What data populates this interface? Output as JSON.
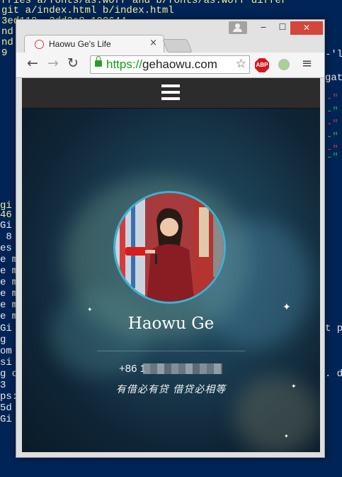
{
  "terminal": {
    "lines": [
      {
        "text": "rries a/fonts/as.woff and b/fonts/as.woff differ",
        "color": "y"
      },
      {
        "text": "git a/index.html b/index.html",
        "color": "y"
      },
      {
        "text": "3ed118..3dd2a8 100644",
        "color": "y"
      },
      {
        "text": "nd",
        "color": "y"
      },
      {
        "text": "nd",
        "color": "y"
      },
      {
        "text": "9",
        "color": "y"
      }
    ],
    "left_lines": [
      "gi",
      "46",
      "Gi",
      " 8",
      "es",
      "e m",
      "e m",
      "e m",
      "e m",
      "e m",
      "e m",
      "Gi",
      "g",
      "om",
      "si",
      "g o",
      "3",
      "ps:",
      "5d",
      "Gi"
    ],
    "right_lines": [
      "-'l",
      "gat",
      "",
      "",
      "",
      "",
      "t p",
      "",
      ". d"
    ]
  },
  "window_controls": {
    "minimize": "‒",
    "maximize": "☐",
    "close": "✕"
  },
  "tab": {
    "title": "Haowu Ge's Life",
    "close": "×"
  },
  "toolbar": {
    "back_icon": "arrow-left",
    "forward_icon": "arrow-right",
    "reload_icon": "reload",
    "url_scheme": "https://",
    "url_host": "gehaowu.com",
    "abp_label": "ABP"
  },
  "profile": {
    "name": "Haowu Ge",
    "phone": "+86 1",
    "motto": "有借必有贷 借贷必相等"
  },
  "colors": {
    "terminal_bg": "#012456",
    "close_button": "#d4453b",
    "avatar_ring": "#3bb2d4",
    "nav_bar": "#2c2c2c"
  }
}
